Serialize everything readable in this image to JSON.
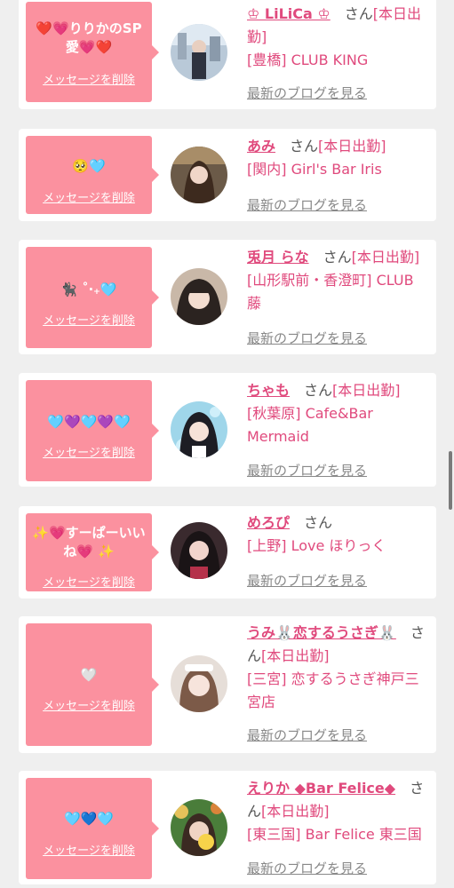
{
  "items": [
    {
      "message": "❤️💗りりかのSP愛💗❤️",
      "delete_label": "メッセージを削除",
      "name": "♔ LiLiCa ♔",
      "san": "さん",
      "status": "[本日出勤]",
      "shop": "[豊橋] CLUB KING",
      "blog_label": "最新のブログを見る"
    },
    {
      "message": "🥺🩵",
      "delete_label": "メッセージを削除",
      "name": "あみ",
      "san": "さん",
      "status": "[本日出勤]",
      "shop": "[関内] Girl's Bar Iris",
      "blog_label": "最新のブログを見る"
    },
    {
      "message": "🐈‍⬛ ˚‧₊🩵",
      "delete_label": "メッセージを削除",
      "name": "兎月 らな",
      "san": "さん",
      "status": "[本日出勤]",
      "shop": "[山形駅前・香澄町] CLUB 藤",
      "blog_label": "最新のブログを見る"
    },
    {
      "message": "🩵💜🩵💜🩵",
      "delete_label": "メッセージを削除",
      "name": "ちゃも",
      "san": "さん",
      "status": "[本日出勤]",
      "shop": "[秋葉原] Cafe&Bar Mermaid",
      "blog_label": "最新のブログを見る"
    },
    {
      "message": "✨💗すーぱーいいね💗 ✨",
      "delete_label": "メッセージを削除",
      "name": "めろぴ",
      "san": "さん",
      "status": "",
      "shop": "[上野] Love ほりっく",
      "blog_label": "最新のブログを見る"
    },
    {
      "message": "🤍",
      "delete_label": "メッセージを削除",
      "name": "うみ🐰恋するうさぎ🐰",
      "san": "さん",
      "status": "[本日出勤]",
      "shop": "[三宮] 恋するうさぎ神戸三宮店",
      "blog_label": "最新のブログを見る"
    },
    {
      "message": "🩵💙🩵",
      "delete_label": "メッセージを削除",
      "name": "えりか ◆Bar Felice◆",
      "san": "さん",
      "status": "[本日出勤]",
      "shop": "[東三国] Bar Felice 東三国",
      "blog_label": "最新のブログを見る"
    }
  ],
  "colors": {
    "page_bg": "#efefef",
    "card_bg": "#ffffff",
    "message_bg": "#fb919f",
    "name": "#e04a7d",
    "text": "#555555",
    "link_gray": "#888888"
  }
}
